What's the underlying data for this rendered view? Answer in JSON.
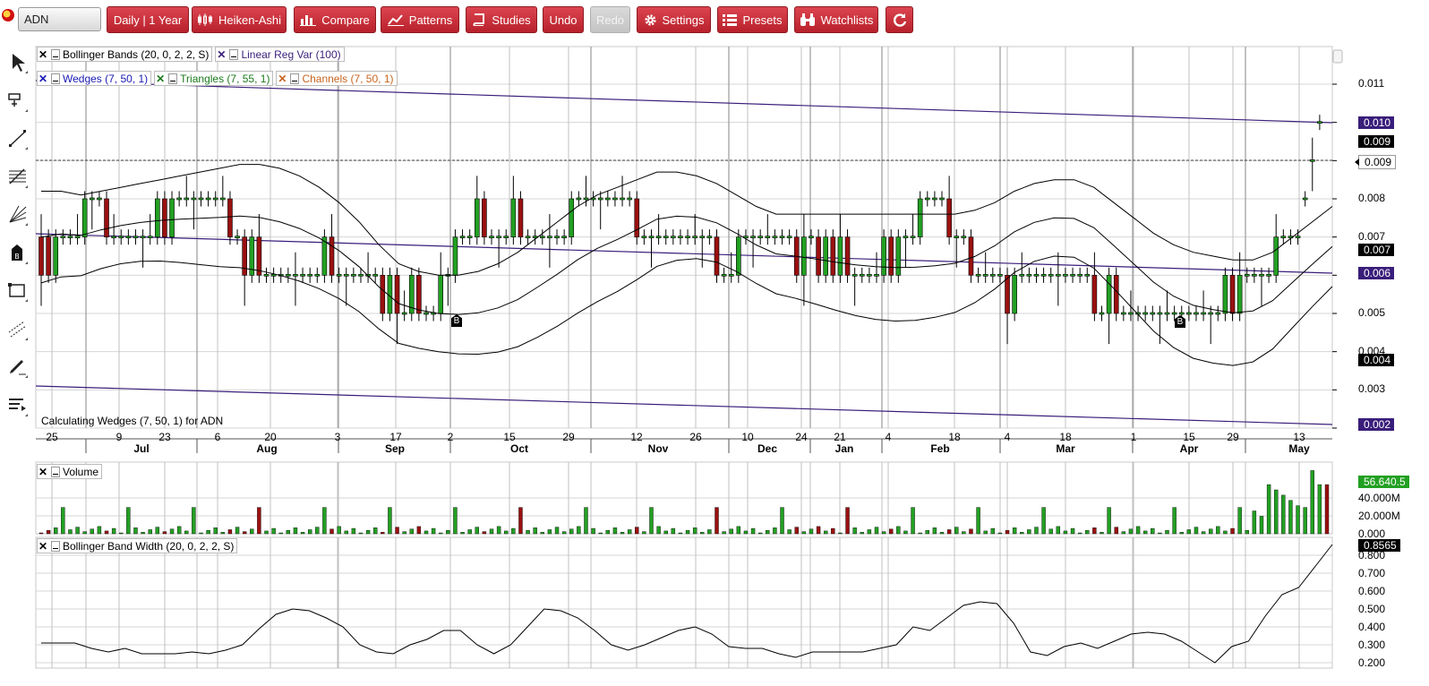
{
  "toolbar": {
    "symbol": "ADN",
    "buttons": [
      {
        "label": "Daily | 1 Year",
        "icon": ""
      },
      {
        "label": "Heiken-Ashi",
        "icon": "candlestick-icon"
      },
      {
        "label": "Compare",
        "icon": "bar-chart-icon"
      },
      {
        "label": "Patterns",
        "icon": "line-chart-icon"
      },
      {
        "label": "Studies",
        "icon": "book-icon"
      },
      {
        "label": "Undo",
        "icon": ""
      },
      {
        "label": "Redo",
        "icon": "",
        "disabled": true
      },
      {
        "label": "Settings",
        "icon": "gear-icon"
      },
      {
        "label": "Presets",
        "icon": "list-icon"
      },
      {
        "label": "Watchlists",
        "icon": "binoculars-icon"
      },
      {
        "label": "",
        "icon": "refresh-icon"
      }
    ]
  },
  "drawing_tools": [
    "pointer-icon",
    "crosshair-annotation-icon",
    "trendline-icon",
    "fibonacci-icon",
    "gann-fan-icon",
    "bid-marker-icon",
    "rectangle-icon",
    "channel-icon",
    "pencil-icon",
    "text-list-icon"
  ],
  "legends": {
    "row1": [
      {
        "label": "Bollinger Bands (20, 0, 2, 2, S)",
        "color": "#000000"
      },
      {
        "label": "Linear Reg Var (100)",
        "color": "#3a1e7a"
      }
    ],
    "row2": [
      {
        "label": "Wedges (7, 50, 1)",
        "color": "#1a1ab4"
      },
      {
        "label": "Triangles (7, 55, 1)",
        "color": "#1a7a1a"
      },
      {
        "label": "Channels (7, 50, 1)",
        "color": "#c8641e"
      }
    ],
    "volume": "Volume",
    "bbw": "Bollinger Band Width (20, 0, 2, 2, S)"
  },
  "status_text": "Calculating Wedges (7, 50, 1) for ADN",
  "price_axis": {
    "ticks": [
      "0.011",
      "0.010",
      "0.009",
      "0.008",
      "0.007",
      "0.006",
      "0.005",
      "0.004",
      "0.003",
      "0.002"
    ]
  },
  "price_tags": [
    {
      "value": "0.010",
      "bg": "#3a1e7a"
    },
    {
      "value": "0.009",
      "bg": "#000000"
    },
    {
      "value": "0.009",
      "bg": "#ffffff",
      "fg": "#000000"
    },
    {
      "value": "0.007",
      "bg": "#000000"
    },
    {
      "value": "0.006",
      "bg": "#3a1e7a"
    },
    {
      "value": "0.004",
      "bg": "#000000"
    },
    {
      "value": "0.002",
      "bg": "#3a1e7a"
    }
  ],
  "volume_axis": {
    "ticks": [
      "40.000M",
      "20.000M",
      "0.000"
    ],
    "last": "56.640.5"
  },
  "bbw_axis": {
    "ticks": [
      "0.800",
      "0.700",
      "0.600",
      "0.500",
      "0.400",
      "0.300",
      "0.200"
    ],
    "last": "0.8565"
  },
  "x_axis": {
    "days": [
      "25",
      "9",
      "23",
      "6",
      "20",
      "3",
      "17",
      "2",
      "15",
      "29",
      "12",
      "26",
      "10",
      "24",
      "21",
      "4",
      "18",
      "4",
      "18",
      "1",
      "15",
      "29",
      "13"
    ],
    "months": [
      "Jul",
      "Aug",
      "Sep",
      "Oct",
      "Nov",
      "Dec",
      "Jan",
      "Feb",
      "Mar",
      "Apr",
      "May"
    ]
  },
  "markers": [
    "B",
    "B"
  ],
  "chart_data": {
    "type": "candlestick",
    "symbol": "ADN",
    "ylim": [
      0.002,
      0.011
    ],
    "close": [
      0.006,
      0.006,
      0.007,
      0.007,
      0.007,
      0.007,
      0.008,
      0.008,
      0.008,
      0.007,
      0.007,
      0.007,
      0.007,
      0.007,
      0.007,
      0.007,
      0.008,
      0.007,
      0.008,
      0.008,
      0.008,
      0.008,
      0.008,
      0.008,
      0.008,
      0.008,
      0.007,
      0.007,
      0.006,
      0.007,
      0.006,
      0.006,
      0.006,
      0.006,
      0.006,
      0.006,
      0.006,
      0.006,
      0.006,
      0.007,
      0.006,
      0.006,
      0.006,
      0.006,
      0.006,
      0.006,
      0.006,
      0.005,
      0.006,
      0.005,
      0.005,
      0.006,
      0.005,
      0.005,
      0.005,
      0.006,
      0.006,
      0.007,
      0.007,
      0.007,
      0.008,
      0.007,
      0.007,
      0.007,
      0.007,
      0.008,
      0.007,
      0.007,
      0.007,
      0.007,
      0.007,
      0.007,
      0.007,
      0.008,
      0.008,
      0.008,
      0.008,
      0.008,
      0.008,
      0.008,
      0.008,
      0.008,
      0.007,
      0.007,
      0.007,
      0.007,
      0.007,
      0.007,
      0.007,
      0.007,
      0.007,
      0.007,
      0.007,
      0.006,
      0.006,
      0.006,
      0.007,
      0.007,
      0.007,
      0.007,
      0.007,
      0.007,
      0.007,
      0.007,
      0.006,
      0.007,
      0.007,
      0.006,
      0.007,
      0.006,
      0.007,
      0.006,
      0.006,
      0.006,
      0.006,
      0.006,
      0.007,
      0.006,
      0.007,
      0.007,
      0.007,
      0.008,
      0.008,
      0.008,
      0.008,
      0.007,
      0.007,
      0.007,
      0.006,
      0.006,
      0.006,
      0.006,
      0.006,
      0.005,
      0.006,
      0.006,
      0.006,
      0.006,
      0.006,
      0.006,
      0.006,
      0.006,
      0.006,
      0.006,
      0.006,
      0.005,
      0.005,
      0.006,
      0.005,
      0.005,
      0.005,
      0.005,
      0.005,
      0.005,
      0.005,
      0.005,
      0.005,
      0.005,
      0.005,
      0.005,
      0.005,
      0.005,
      0.005,
      0.006,
      0.005,
      0.006,
      0.006,
      0.006,
      0.006,
      0.006,
      0.007,
      0.007,
      0.007,
      0.007,
      0.008,
      0.009,
      0.01,
      0.01
    ],
    "open": [
      0.007,
      0.007,
      0.006,
      0.007,
      0.007,
      0.007,
      0.007,
      0.008,
      0.008,
      0.008,
      0.007,
      0.007,
      0.007,
      0.007,
      0.007,
      0.007,
      0.007,
      0.008,
      0.007,
      0.008,
      0.008,
      0.008,
      0.008,
      0.008,
      0.008,
      0.008,
      0.008,
      0.007,
      0.007,
      0.006,
      0.007,
      0.006,
      0.006,
      0.006,
      0.006,
      0.006,
      0.006,
      0.006,
      0.006,
      0.006,
      0.007,
      0.006,
      0.006,
      0.006,
      0.006,
      0.006,
      0.006,
      0.006,
      0.005,
      0.006,
      0.005,
      0.005,
      0.006,
      0.005,
      0.005,
      0.005,
      0.006,
      0.006,
      0.007,
      0.007,
      0.007,
      0.008,
      0.007,
      0.007,
      0.007,
      0.007,
      0.008,
      0.007,
      0.007,
      0.007,
      0.007,
      0.007,
      0.007,
      0.007,
      0.008,
      0.008,
      0.008,
      0.008,
      0.008,
      0.008,
      0.008,
      0.008,
      0.008,
      0.007,
      0.007,
      0.007,
      0.007,
      0.007,
      0.007,
      0.007,
      0.007,
      0.007,
      0.007,
      0.007,
      0.006,
      0.006,
      0.006,
      0.007,
      0.007,
      0.007,
      0.007,
      0.007,
      0.007,
      0.007,
      0.007,
      0.006,
      0.007,
      0.007,
      0.006,
      0.007,
      0.006,
      0.007,
      0.006,
      0.006,
      0.006,
      0.006,
      0.006,
      0.007,
      0.006,
      0.007,
      0.007,
      0.007,
      0.008,
      0.008,
      0.008,
      0.008,
      0.007,
      0.007,
      0.007,
      0.006,
      0.006,
      0.006,
      0.006,
      0.006,
      0.005,
      0.006,
      0.006,
      0.006,
      0.006,
      0.006,
      0.006,
      0.006,
      0.006,
      0.006,
      0.006,
      0.006,
      0.005,
      0.005,
      0.006,
      0.005,
      0.005,
      0.005,
      0.005,
      0.005,
      0.005,
      0.005,
      0.005,
      0.005,
      0.005,
      0.005,
      0.005,
      0.005,
      0.005,
      0.005,
      0.006,
      0.005,
      0.006,
      0.006,
      0.006,
      0.006,
      0.006,
      0.007,
      0.007,
      0.007,
      0.008,
      0.009,
      0.01
    ],
    "bb_upper": [
      0.0082,
      0.0082,
      0.0081,
      0.0082,
      0.0083,
      0.0084,
      0.0085,
      0.0086,
      0.0087,
      0.0088,
      0.0089,
      0.0089,
      0.0088,
      0.0086,
      0.0083,
      0.0079,
      0.0074,
      0.0068,
      0.0063,
      0.0061,
      0.006,
      0.006,
      0.0061,
      0.0063,
      0.0066,
      0.007,
      0.0074,
      0.0078,
      0.0081,
      0.0083,
      0.0085,
      0.0087,
      0.0087,
      0.0086,
      0.0084,
      0.0081,
      0.0078,
      0.0076,
      0.0076,
      0.0076,
      0.0076,
      0.0076,
      0.0076,
      0.0076,
      0.0076,
      0.0076,
      0.0076,
      0.0077,
      0.0079,
      0.0082,
      0.0084,
      0.0085,
      0.0085,
      0.0083,
      0.0079,
      0.0075,
      0.0071,
      0.0068,
      0.0066,
      0.0065,
      0.0064,
      0.0064,
      0.0066,
      0.007,
      0.0074,
      0.0078
    ],
    "bb_width": [
      0.31,
      0.31,
      0.31,
      0.28,
      0.26,
      0.28,
      0.25,
      0.25,
      0.25,
      0.26,
      0.25,
      0.27,
      0.3,
      0.39,
      0.47,
      0.5,
      0.49,
      0.45,
      0.4,
      0.3,
      0.26,
      0.25,
      0.3,
      0.33,
      0.38,
      0.38,
      0.3,
      0.25,
      0.3,
      0.4,
      0.5,
      0.49,
      0.45,
      0.38,
      0.3,
      0.27,
      0.3,
      0.34,
      0.38,
      0.4,
      0.36,
      0.29,
      0.28,
      0.28,
      0.25,
      0.23,
      0.26,
      0.26,
      0.26,
      0.26,
      0.28,
      0.3,
      0.4,
      0.38,
      0.45,
      0.52,
      0.54,
      0.53,
      0.42,
      0.26,
      0.24,
      0.29,
      0.31,
      0.28,
      0.32,
      0.36,
      0.37,
      0.36,
      0.32,
      0.26,
      0.2,
      0.29,
      0.32,
      0.46,
      0.58,
      0.62,
      0.74,
      0.86
    ]
  }
}
